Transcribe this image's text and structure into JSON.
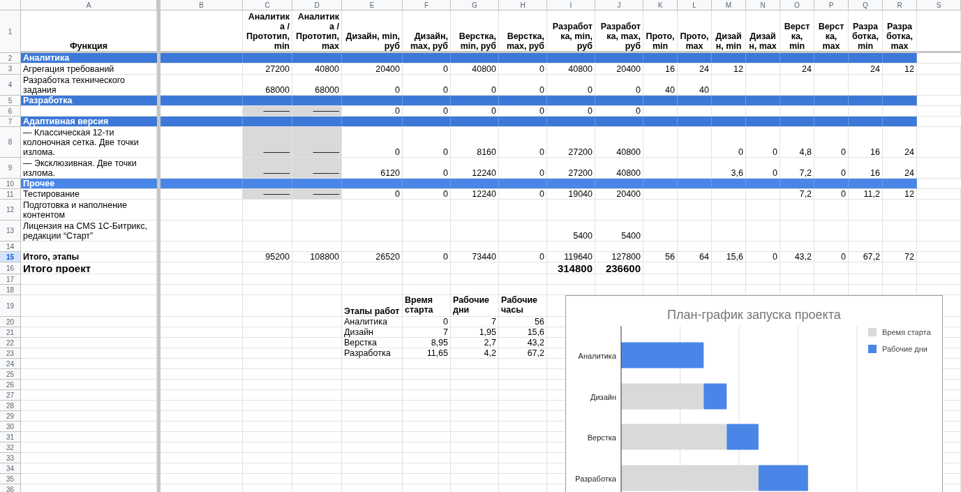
{
  "columns": [
    "A",
    "B",
    "C",
    "D",
    "E",
    "F",
    "G",
    "H",
    "I",
    "J",
    "K",
    "L",
    "M",
    "N",
    "O",
    "P",
    "Q",
    "R",
    "S"
  ],
  "rows": [
    {
      "number": "1",
      "kind": "header",
      "selected": false,
      "cells": {
        "A": "Функция",
        "C": "Аналитика / Прототип, min",
        "D": "Аналитика / Прототип, max",
        "E": "Дизайн, min, руб",
        "F": "Дизайн, max, руб",
        "G": "Верстка, min, руб",
        "H": "Верстка, max, руб",
        "I": "Разработка, min, руб",
        "J": "Разработка, max, руб",
        "K": "Прото, min",
        "L": "Прото, max",
        "M": "Дизайн, min",
        "N": "Дизайн, max",
        "O": "Верстка, min",
        "P": "Верстка, max",
        "Q": "Разработка, min",
        "R": "Разработка, max"
      }
    },
    {
      "number": "2",
      "kind": "section",
      "selected": false,
      "color": "#3c78d8",
      "cells": {
        "A": "Аналитика"
      }
    },
    {
      "number": "3",
      "kind": "data",
      "selected": false,
      "cells": {
        "A": "Агрегация требований",
        "C": "27200",
        "D": "40800",
        "E": "20400",
        "F": "0",
        "G": "40800",
        "H": "0",
        "I": "40800",
        "J": "20400",
        "K": "16",
        "L": "24",
        "M": "12",
        "O": "24",
        "Q": "24",
        "R": "12"
      }
    },
    {
      "number": "4",
      "kind": "data",
      "selected": false,
      "cells": {
        "A": "Разработка технического задания",
        "C": "68000",
        "D": "68000",
        "E": "0",
        "F": "0",
        "G": "0",
        "H": "0",
        "I": "0",
        "J": "0",
        "K": "40",
        "L": "40"
      }
    },
    {
      "number": "5",
      "kind": "section",
      "selected": false,
      "color": "#3c78d8",
      "cells": {
        "A": "Разработка"
      }
    },
    {
      "number": "6",
      "kind": "data",
      "selected": false,
      "cells": {
        "C": {
          "text": "———",
          "shaded": true
        },
        "D": {
          "text": "———",
          "shaded": true
        },
        "E": "0",
        "F": "0",
        "G": "0",
        "H": "0",
        "I": "0",
        "J": "0"
      }
    },
    {
      "number": "7",
      "kind": "section",
      "selected": false,
      "color": "#3c78d8",
      "cells": {
        "A": "Адаптивная версия"
      }
    },
    {
      "number": "8",
      "kind": "data",
      "selected": false,
      "cells": {
        "A": "— Классическая 12-ти колоночная сетка. Две точки излома.",
        "C": {
          "text": "———",
          "shaded": true
        },
        "D": {
          "text": "———",
          "shaded": true
        },
        "E": "0",
        "F": "0",
        "G": "8160",
        "H": "0",
        "I": "27200",
        "J": "40800",
        "M": "0",
        "N": "0",
        "O": "4,8",
        "P": "0",
        "Q": "16",
        "R": "24"
      }
    },
    {
      "number": "9",
      "kind": "data",
      "selected": false,
      "cells": {
        "A": "— Эксклюзивная. Две точки излома.",
        "C": {
          "text": "———",
          "shaded": true
        },
        "D": {
          "text": "———",
          "shaded": true
        },
        "E": "6120",
        "F": "0",
        "G": "12240",
        "H": "0",
        "I": "27200",
        "J": "40800",
        "M": "3,6",
        "N": "0",
        "O": "7,2",
        "P": "0",
        "Q": "16",
        "R": "24"
      }
    },
    {
      "number": "10",
      "kind": "section",
      "selected": false,
      "color": "#4a86e8",
      "cells": {
        "A": "Прочее"
      }
    },
    {
      "number": "11",
      "kind": "data",
      "selected": false,
      "cells": {
        "A": "Тестирование",
        "C": {
          "text": "———",
          "shaded": true
        },
        "D": {
          "text": "———",
          "shaded": true
        },
        "E": "0",
        "F": "0",
        "G": "12240",
        "H": "0",
        "I": "19040",
        "J": "20400",
        "O": "7,2",
        "P": "0",
        "Q": "11,2",
        "R": "12"
      }
    },
    {
      "number": "12",
      "kind": "data",
      "selected": false,
      "cells": {
        "A": "Подготовка и наполнение контентом"
      }
    },
    {
      "number": "13",
      "kind": "data",
      "selected": false,
      "cells": {
        "A": "Лицензия на CMS 1С-Битрикс, редакции “Старт”",
        "I": "5400",
        "J": "5400"
      }
    },
    {
      "number": "14",
      "kind": "data",
      "selected": false
    },
    {
      "number": "15",
      "kind": "total",
      "selected": true,
      "cells": {
        "A": "Итого, этапы",
        "C": "95200",
        "D": "108800",
        "E": "26520",
        "F": "0",
        "G": "73440",
        "H": "0",
        "I": "119640",
        "J": "127800",
        "K": "56",
        "L": "64",
        "M": "15,6",
        "N": "0",
        "O": "43,2",
        "P": "0",
        "Q": "67,2",
        "R": "72"
      }
    },
    {
      "number": "16",
      "kind": "grand_total",
      "selected": false,
      "cells": {
        "A": "Итого проект",
        "I": "314800",
        "J": "236600"
      }
    },
    {
      "number": "17",
      "kind": "data",
      "selected": false
    },
    {
      "number": "18",
      "kind": "data",
      "selected": false
    },
    {
      "number": "19",
      "kind": "stage_header",
      "selected": false,
      "cells": {
        "E": "Этапы работ",
        "F": "Время старта",
        "G": "Рабочие дни",
        "H": "Рабочие часы"
      }
    },
    {
      "number": "20",
      "kind": "stage",
      "selected": false,
      "cells": {
        "E": "Аналитика",
        "F": "0",
        "G": "7",
        "H": "56"
      }
    },
    {
      "number": "21",
      "kind": "stage",
      "selected": false,
      "cells": {
        "E": "Дизайн",
        "F": "7",
        "G": "1,95",
        "H": "15,6"
      }
    },
    {
      "number": "22",
      "kind": "stage",
      "selected": false,
      "cells": {
        "E": "Верстка",
        "F": "8,95",
        "G": "2,7",
        "H": "43,2"
      }
    },
    {
      "number": "23",
      "kind": "stage",
      "selected": false,
      "cells": {
        "E": "Разработка",
        "F": "11,65",
        "G": "4,2",
        "H": "67,2"
      }
    },
    {
      "number": "24",
      "kind": "data",
      "selected": false
    },
    {
      "number": "25",
      "kind": "data",
      "selected": false
    },
    {
      "number": "26",
      "kind": "data",
      "selected": false
    },
    {
      "number": "27",
      "kind": "data",
      "selected": false
    },
    {
      "number": "28",
      "kind": "data",
      "selected": false
    },
    {
      "number": "29",
      "kind": "data",
      "selected": false
    },
    {
      "number": "30",
      "kind": "data",
      "selected": false
    },
    {
      "number": "31",
      "kind": "data",
      "selected": false
    },
    {
      "number": "32",
      "kind": "data",
      "selected": false
    },
    {
      "number": "33",
      "kind": "data",
      "selected": false
    },
    {
      "number": "34",
      "kind": "data",
      "selected": false
    },
    {
      "number": "35",
      "kind": "data",
      "selected": false
    },
    {
      "number": "36",
      "kind": "data",
      "selected": false
    }
  ],
  "chart": {
    "title": "План-график запуска проекта",
    "categories": [
      "Аналитика",
      "Дизайн",
      "Верстка",
      "Разработка"
    ],
    "legend": [
      {
        "label": "Время старта",
        "color": "#d9d9d9"
      },
      {
        "label": "Рабочие дни",
        "color": "#4a86e8"
      }
    ]
  }
}
